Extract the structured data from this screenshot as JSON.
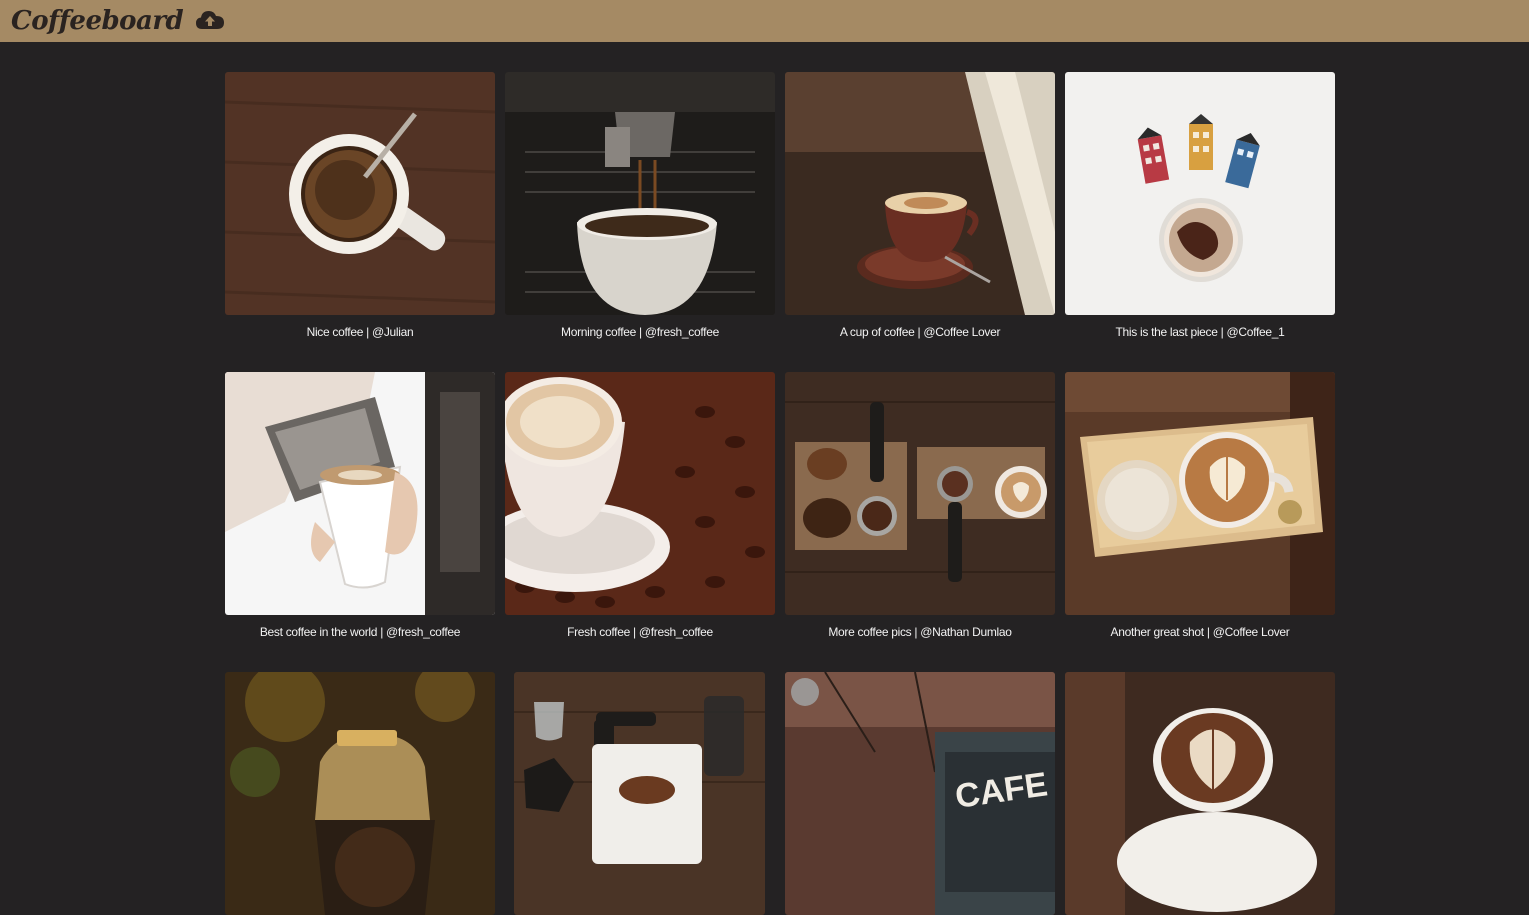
{
  "header": {
    "logo": "Coffeeboard",
    "upload_icon": "cloud-upload-icon"
  },
  "posts": [
    {
      "caption": "Nice coffee | @Julian"
    },
    {
      "caption": "Morning coffee | @fresh_coffee"
    },
    {
      "caption": "A cup of coffee | @Coffee Lover"
    },
    {
      "caption": "This is the last piece | @Coffee_1"
    },
    {
      "caption": "Best coffee in the world | @fresh_coffee"
    },
    {
      "caption": "Fresh coffee | @fresh_coffee"
    },
    {
      "caption": "More coffee pics | @Nathan Dumlao"
    },
    {
      "caption": "Another great shot | @Coffee Lover"
    }
  ],
  "colors": {
    "header_bg": "#a58a64",
    "page_bg": "#242223",
    "caption_text": "#f2f2f2"
  }
}
